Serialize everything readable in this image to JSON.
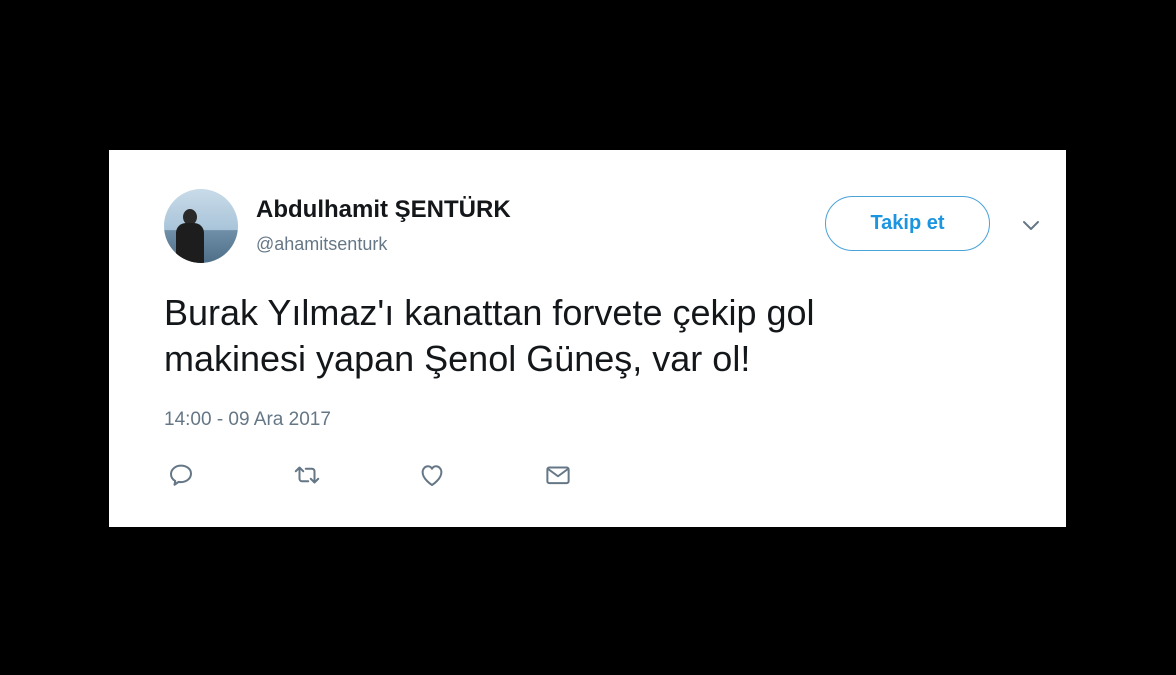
{
  "tweet": {
    "author": {
      "name": "Abdulhamit ŞENTÜRK",
      "handle": "@ahamitsenturk"
    },
    "follow_label": "Takip et",
    "text": "Burak Yılmaz'ı kanattan forvete çekip gol\nmakinesi yapan Şenol Güneş, var ol!",
    "timestamp": "14:00 - 09 Ara 2017",
    "actions": {
      "reply_icon": "reply-icon",
      "retweet_icon": "retweet-icon",
      "like_icon": "heart-icon",
      "message_icon": "envelope-icon"
    }
  },
  "colors": {
    "background": "#000000",
    "card": "#ffffff",
    "accent": "#1b95e0",
    "text": "#14171a",
    "muted": "#657786"
  }
}
